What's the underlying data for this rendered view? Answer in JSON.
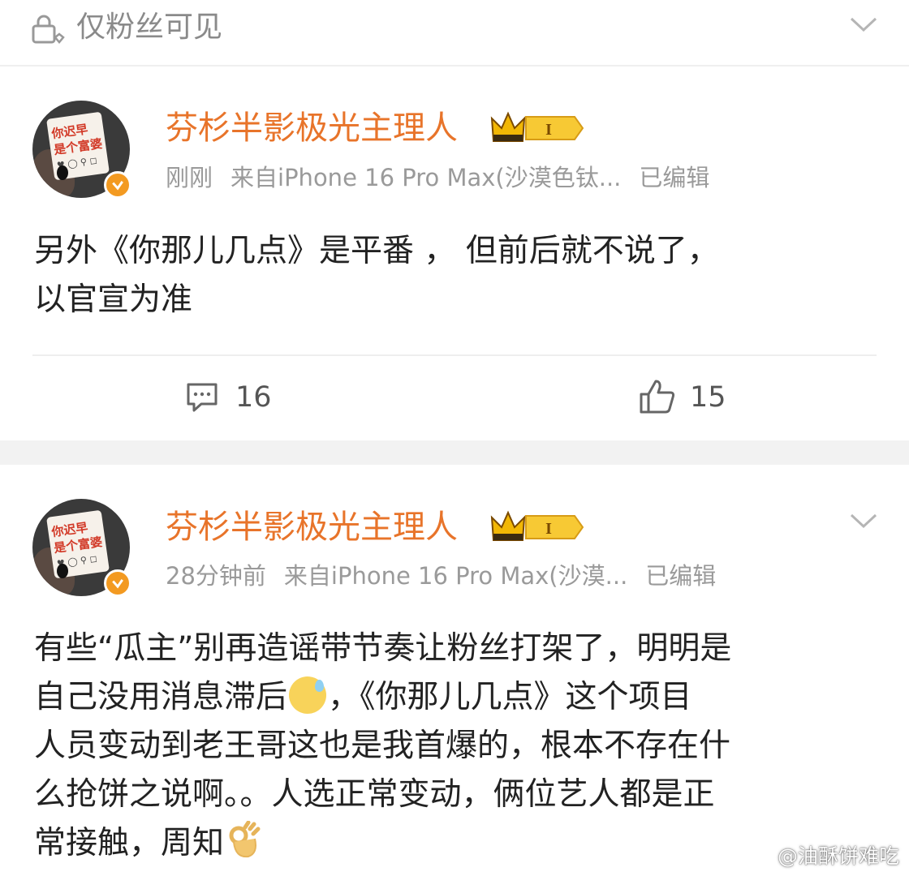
{
  "visibility": {
    "label": "仅粉丝可见"
  },
  "posts": [
    {
      "username": "芬杉半影极光主理人",
      "level_badge": "I",
      "time": "刚刚",
      "source": "来自iPhone 16 Pro Max(沙漠色钛...",
      "edited": "已编辑",
      "content_lines": [
        "另外《你那儿几点》是平番 ， 但前后就不说了，",
        "以官宣为准"
      ],
      "comment_count": "16",
      "like_count": "15"
    },
    {
      "username": "芬杉半影极光主理人",
      "level_badge": "I",
      "time": "28分钟前",
      "source": "来自iPhone 16 Pro Max(沙漠...",
      "edited": "已编辑",
      "content_line1": "有些“瓜主”别再造谣带节奏让粉丝打架了，明明是",
      "content_line2a": "自己没用消息滞后",
      "content_line2b": "，《你那儿几点》这个项目",
      "content_line3": "人员变动到老王哥这也是我首爆的，根本不存在什",
      "content_line4": "么抢饼之说啊。。人选正常变动，俩位艺人都是正",
      "content_line5": "常接触，周知"
    }
  ],
  "avatar_text": {
    "line1": "你迟早",
    "line2": "是个富婆"
  },
  "watermark": "@油酥饼难吃",
  "colors": {
    "username": "#e8742a",
    "meta": "#9a9a9a",
    "badge": "#f39a21",
    "separator": "#f2f2f2"
  }
}
